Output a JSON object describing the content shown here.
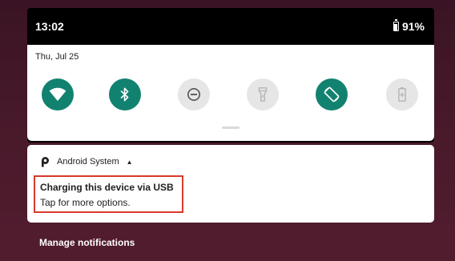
{
  "status_bar": {
    "time": "13:02",
    "battery": "91%"
  },
  "quick_settings": {
    "date": "Thu, Jul 25",
    "tiles": [
      {
        "name": "wifi",
        "state": "on",
        "icon": "wifi-icon"
      },
      {
        "name": "bluetooth",
        "state": "on",
        "icon": "bluetooth-icon"
      },
      {
        "name": "do-not-disturb",
        "state": "off",
        "icon": "do-not-disturb-icon"
      },
      {
        "name": "flashlight",
        "state": "off",
        "icon": "flashlight-icon"
      },
      {
        "name": "auto-rotate",
        "state": "on",
        "icon": "auto-rotate-icon"
      },
      {
        "name": "battery-saver",
        "state": "off",
        "icon": "battery-saver-icon"
      }
    ],
    "colors": {
      "tile_on": "#128270",
      "tile_off": "#e6e6e6"
    }
  },
  "notification": {
    "app_name": "Android System",
    "title": "Charging this device via USB",
    "text": "Tap for more options.",
    "highlight_color": "#d83a2b"
  },
  "footer": {
    "manage_label": "Manage notifications"
  }
}
